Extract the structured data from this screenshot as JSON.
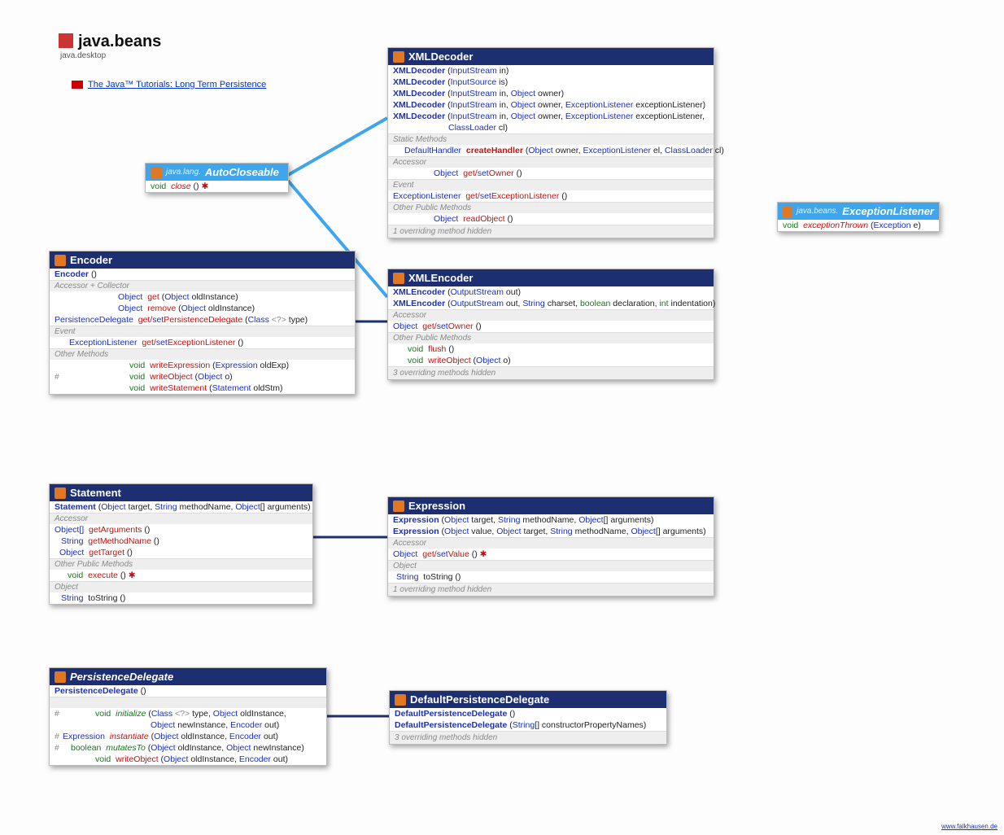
{
  "package": {
    "name": "java.beans",
    "module": "java.desktop"
  },
  "tutorial": {
    "label": "The Java™ Tutorials: Long Term Persistence"
  },
  "autocloseable": {
    "pkg": "java.lang.",
    "name": "AutoCloseable",
    "m1_ret": "void",
    "m1_name": "close",
    "m1_args": "()",
    "m1_exc": "✱"
  },
  "exlistener": {
    "pkg": "java.beans.",
    "name": "ExceptionListener",
    "m1_ret": "void",
    "m1_name": "exceptionThrown",
    "m1_args": "(",
    "m1_t1": "Exception",
    "m1_p1": " e)"
  },
  "xmldecoder": {
    "name": "XMLDecoder",
    "c1": "XMLDecoder",
    "c1a": "(",
    "c1t1": "InputStream",
    "c1p1": " in)",
    "c2": "XMLDecoder",
    "c2a": "(",
    "c2t1": "InputSource",
    "c2p1": " is)",
    "c3": "XMLDecoder",
    "c3a": "(",
    "c3t1": "InputStream",
    "c3p1": " in, ",
    "c3t2": "Object",
    "c3p2": " owner)",
    "c4": "XMLDecoder",
    "c4a": "(",
    "c4t1": "InputStream",
    "c4p1": " in, ",
    "c4t2": "Object",
    "c4p2": " owner, ",
    "c4t3": "ExceptionListener",
    "c4p3": " exceptionListener)",
    "c5": "XMLDecoder",
    "c5a": "(",
    "c5t1": "InputStream",
    "c5p1": " in, ",
    "c5t2": "Object",
    "c5p2": " owner, ",
    "c5t3": "ExceptionListener",
    "c5p3": " exceptionListener,",
    "c5l2_t": "ClassLoader",
    "c5l2_p": " cl)",
    "sect_sm": "Static Methods",
    "sm_ret": "DefaultHandler",
    "sm_name": "createHandler",
    "sm_a": "(",
    "sm_t1": "Object",
    "sm_p1": " owner, ",
    "sm_t2": "ExceptionListener",
    "sm_p2": " el, ",
    "sm_t3": "ClassLoader",
    "sm_p3": " cl)",
    "sect_acc": "Accessor",
    "acc_ret": "Object",
    "acc_name": "get/setOwner",
    "acc_a": "()",
    "sect_ev": "Event",
    "ev_ret": "ExceptionListener",
    "ev_name": "get/setExceptionListener",
    "ev_a": "()",
    "sect_op": "Other Public Methods",
    "op_ret": "Object",
    "op_name": "readObject",
    "op_a": "()",
    "ovr": "1 overriding",
    "ovr2": " method hidden"
  },
  "xmlencoder": {
    "name": "XMLEncoder",
    "c1": "XMLEncoder",
    "c1a": "(",
    "c1t1": "OutputStream",
    "c1p1": " out)",
    "c2": "XMLEncoder",
    "c2a": "(",
    "c2t1": "OutputStream",
    "c2p1": " out, ",
    "c2t2": "String",
    "c2p2": " charset, ",
    "c2k": "boolean",
    "c2p3": " declaration, ",
    "c2k2": "int",
    "c2p4": " indentation)",
    "sect_acc": "Accessor",
    "acc_ret": "Object",
    "acc_name": "get/setOwner",
    "acc_a": "()",
    "sect_op": "Other Public Methods",
    "m1_ret": "void",
    "m1_name": "flush",
    "m1_a": "()",
    "m2_ret": "void",
    "m2_name": "writeObject",
    "m2_a": "(",
    "m2_t": "Object",
    "m2_p": " o)",
    "ovr": "3 overriding",
    "ovr2": " methods hidden"
  },
  "encoder": {
    "name": "Encoder",
    "c1": "Encoder",
    "c1a": "()",
    "sect_ac": "Accessor + Collector",
    "m1_ret": "Object",
    "m1_name": "get",
    "m1_a": "(",
    "m1_t": "Object",
    "m1_p": " oldInstance)",
    "m2_ret": "Object",
    "m2_name": "remove",
    "m2_a": "(",
    "m2_t": "Object",
    "m2_p": " oldInstance)",
    "m3_ret": "PersistenceDelegate",
    "m3_name": "get/setPersistenceDelegate",
    "m3_a": "(",
    "m3_t": "Class",
    "m3_g": "<?>",
    "m3_p": " type)",
    "sect_ev": "Event",
    "ev_ret": "ExceptionListener",
    "ev_name": "get/setExceptionListener",
    "ev_a": "()",
    "sect_om": "Other Methods",
    "om1_ret": "void",
    "om1_name": "writeExpression",
    "om1_a": "(",
    "om1_t": "Expression",
    "om1_p": " oldExp)",
    "om2_ret": "void",
    "om2_name": "writeObject",
    "om2_a": "(",
    "om2_t": "Object",
    "om2_p": " o)",
    "om3_ret": "void",
    "om3_name": "writeStatement",
    "om3_a": "(",
    "om3_t": "Statement",
    "om3_p": " oldStm)"
  },
  "statement": {
    "name": "Statement",
    "c1": "Statement",
    "c1a": "(",
    "c1t1": "Object",
    "c1p1": " target, ",
    "c1t2": "String",
    "c1p2": " methodName, ",
    "c1t3": "Object",
    "c1p3": "[] arguments)",
    "sect_acc": "Accessor",
    "a1_ret": "Object[]",
    "a1_name": "getArguments",
    "a1_a": "()",
    "a2_ret": "String",
    "a2_name": "getMethodName",
    "a2_a": "()",
    "a3_ret": "Object",
    "a3_name": "getTarget",
    "a3_a": "()",
    "sect_op": "Other Public Methods",
    "op_ret": "void",
    "op_name": "execute",
    "op_a": "()",
    "op_exc": "✱",
    "sect_obj": "Object",
    "obj_ret": "String",
    "obj_name": "toString",
    "obj_a": "()"
  },
  "expression": {
    "name": "Expression",
    "c1": "Expression",
    "c1a": "(",
    "c1t1": "Object",
    "c1p1": " target, ",
    "c1t2": "String",
    "c1p2": " methodName, ",
    "c1t3": "Object",
    "c1p3": "[] arguments)",
    "c2": "Expression",
    "c2a": "(",
    "c2t1": "Object",
    "c2p1": " value, ",
    "c2t2": "Object",
    "c2p2": " target, ",
    "c2t3": "String",
    "c2p3": " methodName, ",
    "c2t4": "Object",
    "c2p4": "[] arguments)",
    "sect_acc": "Accessor",
    "acc_ret": "Object",
    "acc_name": "get/setValue",
    "acc_a": "()",
    "acc_exc": "✱",
    "sect_obj": "Object",
    "obj_ret": "String",
    "obj_name": "toString",
    "obj_a": "()",
    "ovr": "1 overriding",
    "ovr2": " method hidden"
  },
  "pdel": {
    "name": "PersistenceDelegate",
    "c1": "PersistenceDelegate",
    "c1a": "()",
    "m1_ret": "void",
    "m1_name": "initialize",
    "m1_a": "(",
    "m1_t1": "Class",
    "m1_g": "<?>",
    "m1_p1": " type, ",
    "m1_t2": "Object",
    "m1_p2": " oldInstance,",
    "m1l2_t1": "Object",
    "m1l2_p1": " newInstance, ",
    "m1l2_t2": "Encoder",
    "m1l2_p2": " out)",
    "m2_ret": "Expression",
    "m2_name": "instantiate",
    "m2_a": "(",
    "m2_t1": "Object",
    "m2_p1": " oldInstance, ",
    "m2_t2": "Encoder",
    "m2_p2": " out)",
    "m3_ret": "boolean",
    "m3_name": "mutatesTo",
    "m3_a": "(",
    "m3_t1": "Object",
    "m3_p1": " oldInstance, ",
    "m3_t2": "Object",
    "m3_p2": " newInstance)",
    "m4_ret": "void",
    "m4_name": "writeObject",
    "m4_a": "(",
    "m4_t1": "Object",
    "m4_p1": " oldInstance, ",
    "m4_t2": "Encoder",
    "m4_p2": " out)"
  },
  "dpdel": {
    "name": "DefaultPersistenceDelegate",
    "c1": "DefaultPersistenceDelegate",
    "c1a": "()",
    "c2": "DefaultPersistenceDelegate",
    "c2a": "(",
    "c2t": "String",
    "c2p": "[] constructorPropertyNames)",
    "ovr": "3 overriding",
    "ovr2": " methods hidden"
  },
  "footer": "www.falkhausen.de"
}
